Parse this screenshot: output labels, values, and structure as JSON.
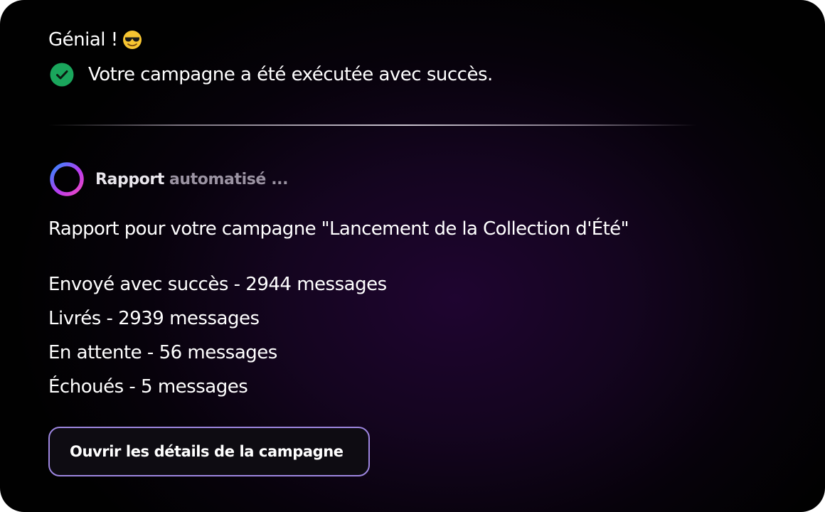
{
  "message": {
    "greeting": "Génial !",
    "greeting_emoji": "smiling-face-with-sunglasses-icon",
    "success_icon": "check-circle-icon",
    "success_text": "Votre campagne a été exécutée avec succès."
  },
  "report": {
    "icon": "loading-ring-icon",
    "label": "Rapport",
    "status": "automatisé ...",
    "title": "Rapport pour votre campagne \"Lancement de la Collection d'Été\"",
    "stats": [
      "Envoyé avec succès - 2944 messages",
      "Livrés - 2939 messages",
      "En attente - 56 messages",
      "Échoués - 5 messages"
    ]
  },
  "actions": {
    "open_details_label": "Ouvrir les détails de la campagne"
  },
  "colors": {
    "success_green": "#1aa65c",
    "button_border": "#9d86e0",
    "ring_gradient": [
      "#2d8cff",
      "#b63cf0",
      "#f048c0"
    ]
  }
}
